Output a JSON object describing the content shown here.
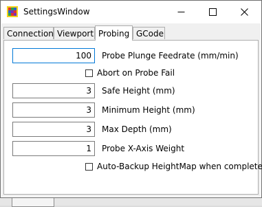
{
  "window": {
    "title": "SettingsWindow",
    "icon": "app-icon",
    "controls": [
      "minimize-icon",
      "maximize-icon",
      "close-icon"
    ]
  },
  "tabs": [
    {
      "label": "Connection",
      "active": false
    },
    {
      "label": "Viewport",
      "active": false
    },
    {
      "label": "Probing",
      "active": true
    },
    {
      "label": "GCode",
      "active": false
    }
  ],
  "probing": {
    "plunge_feedrate": {
      "value": "100",
      "label": "Probe Plunge Feedrate (mm/min)"
    },
    "abort_on_fail": {
      "checked": false,
      "label": "Abort on Probe Fail"
    },
    "safe_height": {
      "value": "3",
      "label": "Safe Height (mm)"
    },
    "minimum_height": {
      "value": "3",
      "label": "Minimum Height (mm)"
    },
    "max_depth": {
      "value": "3",
      "label": "Max Depth (mm)"
    },
    "x_axis_weight": {
      "value": "1",
      "label": "Probe X-Axis Weight"
    },
    "auto_backup": {
      "checked": false,
      "label": "Auto-Backup HeightMap when complete"
    }
  },
  "colors": {
    "focus_border": "#0078d7",
    "tab_border": "#adadad",
    "content_bg": "#f0f0f0"
  }
}
